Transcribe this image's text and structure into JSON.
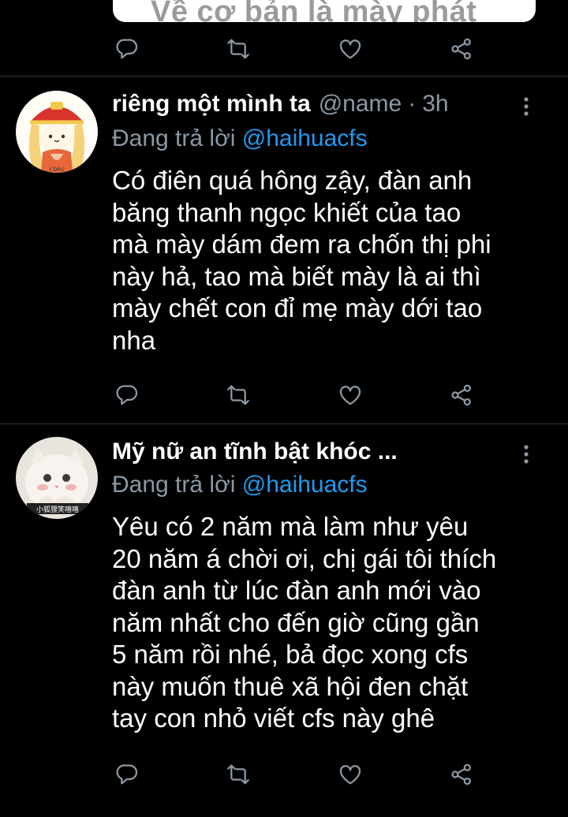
{
  "top_card": {
    "quote_text": "Về cơ bản là mày phát"
  },
  "colors": {
    "background": "#000000",
    "secondary_text": "#8b98a5",
    "mention": "#1d9bf0",
    "divider": "#2f3336"
  },
  "action_icons": [
    "reply-icon",
    "retweet-icon",
    "like-icon",
    "share-icon"
  ],
  "tweets": [
    {
      "display_name": "riêng một mình ta",
      "handle": "@name",
      "separator": "·",
      "time": "3h",
      "reply_prefix": "Đang trả lời",
      "reply_to": "@haihuacfs",
      "text": "Có điên quá hông zậy, đàn anh\nbăng thanh ngọc khiết của tao\nmà mày dám đem ra chốn thị phi\nnày hả, tao mà biết mày là ai thì\nmày chết con đỉ mẹ mày dới tao\nnha",
      "avatar_caption": "r.bkc"
    },
    {
      "display_name": "Mỹ nữ an tĩnh bật khóc ...",
      "reply_prefix": "Đang trả lời",
      "reply_to": "@haihuacfs",
      "text": "Yêu có 2 năm mà làm như yêu\n20 năm á chời ơi, chị gái tôi thích\nđàn anh từ lúc đàn anh mới vào\nnăm nhất cho đến giờ cũng gần\n5 năm rồi nhé, bả đọc xong cfs\nnày muốn thuê xã hội đen chặt\ntay con nhỏ viết cfs này ghê",
      "avatar_caption": "小狐狸笑嘻嘻"
    }
  ]
}
